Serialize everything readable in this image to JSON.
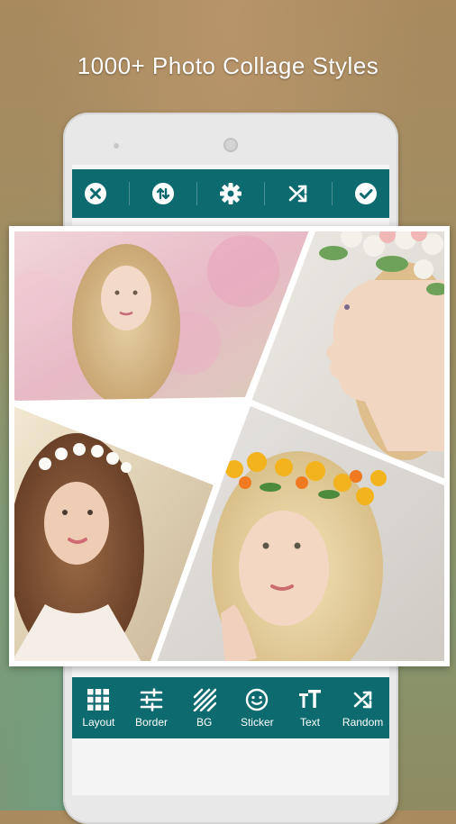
{
  "headline": "1000+ Photo Collage Styles",
  "colors": {
    "toolbar": "#0d6b70",
    "icon": "#ffffff"
  },
  "top_toolbar": {
    "buttons": [
      {
        "icon": "close-circle-icon"
      },
      {
        "icon": "swap-circle-icon"
      },
      {
        "icon": "gear-icon"
      },
      {
        "icon": "shuffle-icon"
      },
      {
        "icon": "check-circle-icon"
      }
    ]
  },
  "collage": {
    "photos": [
      "woman-pink-blossoms",
      "woman-profile-flower-crown",
      "woman-white-flower-crown",
      "woman-yellow-flower-crown"
    ]
  },
  "bottom_toolbar": {
    "items": [
      {
        "label": "Layout",
        "icon": "grid-icon"
      },
      {
        "label": "Border",
        "icon": "sliders-icon"
      },
      {
        "label": "BG",
        "icon": "stripes-icon"
      },
      {
        "label": "Sticker",
        "icon": "smiley-icon"
      },
      {
        "label": "Text",
        "icon": "text-size-icon"
      },
      {
        "label": "Random",
        "icon": "shuffle-icon"
      }
    ]
  }
}
